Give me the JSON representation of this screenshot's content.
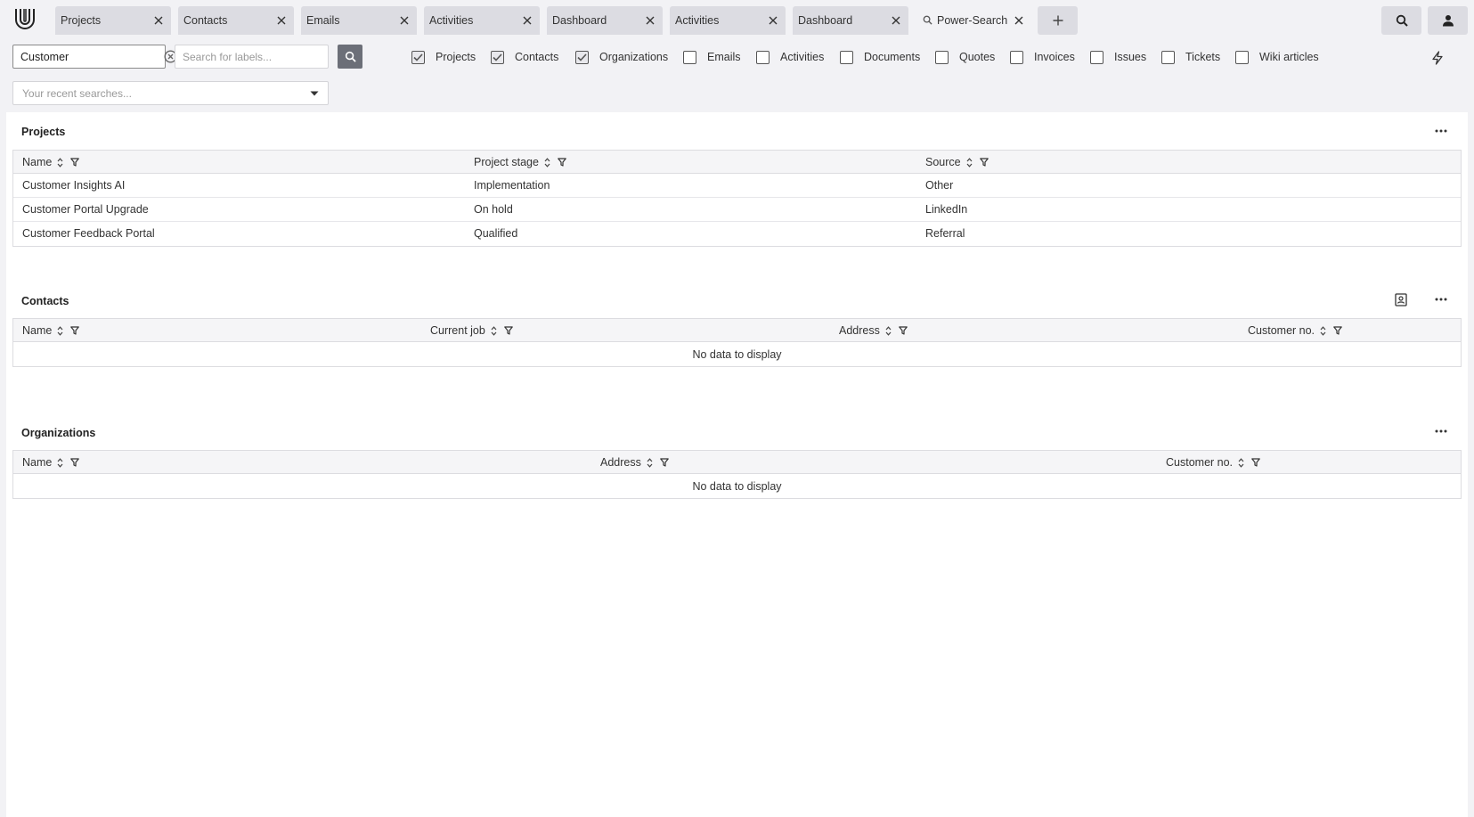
{
  "tabs": [
    {
      "label": "Projects",
      "active": false
    },
    {
      "label": "Contacts",
      "active": false
    },
    {
      "label": "Emails",
      "active": false
    },
    {
      "label": "Activities",
      "active": false
    },
    {
      "label": "Dashboard",
      "active": false
    },
    {
      "label": "Activities",
      "active": false
    },
    {
      "label": "Dashboard",
      "active": false
    },
    {
      "label": "Power-Search",
      "active": true,
      "icon": "search-icon"
    }
  ],
  "search": {
    "value": "Customer",
    "label_placeholder": "Search for labels...",
    "recent_placeholder": "Your recent searches..."
  },
  "filters": [
    {
      "label": "Projects",
      "checked": true
    },
    {
      "label": "Contacts",
      "checked": true
    },
    {
      "label": "Organizations",
      "checked": true
    },
    {
      "label": "Emails",
      "checked": false
    },
    {
      "label": "Activities",
      "checked": false
    },
    {
      "label": "Documents",
      "checked": false
    },
    {
      "label": "Quotes",
      "checked": false
    },
    {
      "label": "Invoices",
      "checked": false
    },
    {
      "label": "Issues",
      "checked": false
    },
    {
      "label": "Tickets",
      "checked": false
    },
    {
      "label": "Wiki articles",
      "checked": false
    }
  ],
  "sections": {
    "projects": {
      "title": "Projects",
      "columns": [
        "Name",
        "Project stage",
        "Source"
      ],
      "rows": [
        [
          "Customer Insights AI",
          "Implementation",
          "Other"
        ],
        [
          "Customer Portal Upgrade",
          "On hold",
          "LinkedIn"
        ],
        [
          "Customer Feedback Portal",
          "Qualified",
          "Referral"
        ]
      ]
    },
    "contacts": {
      "title": "Contacts",
      "columns": [
        "Name",
        "Current job",
        "Address",
        "Customer no."
      ],
      "empty_text": "No data to display"
    },
    "organizations": {
      "title": "Organizations",
      "columns": [
        "Name",
        "Address",
        "Customer no."
      ],
      "empty_text": "No data to display"
    }
  },
  "colors": {
    "background": "#f2f2f5",
    "tab": "#dcdce2",
    "search_button": "#6c6f78",
    "grid_border": "#dcdce0"
  }
}
